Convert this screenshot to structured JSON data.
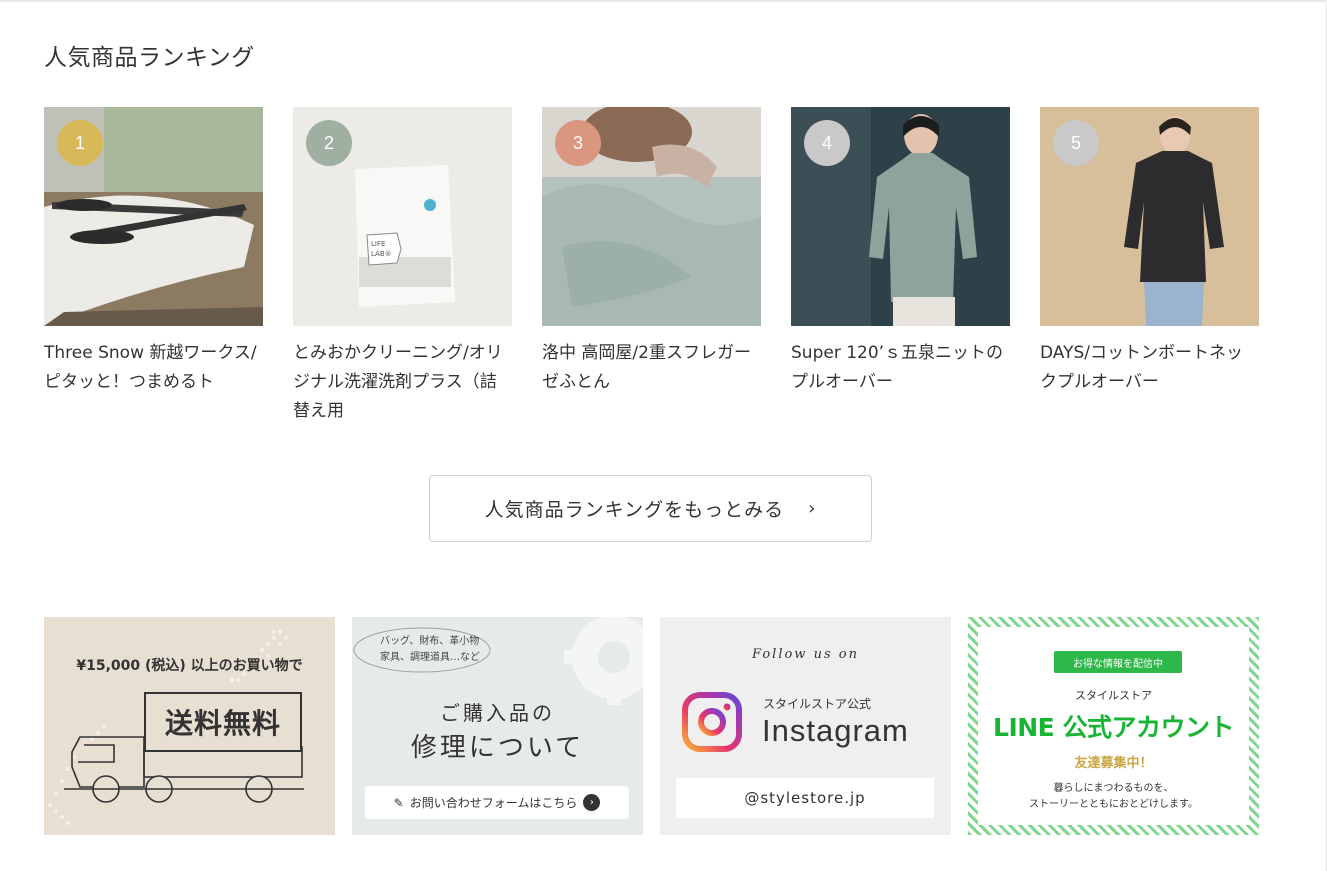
{
  "section": {
    "title": "人気商品ランキング"
  },
  "ranking": [
    {
      "rank": "1",
      "name": "Three Snow 新越ワークス/ピタッと！つまめるト",
      "badge_color": "#d8b95a"
    },
    {
      "rank": "2",
      "name": "とみおかクリーニング/オリジナル洗濯洗剤プラス（詰替え用",
      "badge_color": "#9fb0a2"
    },
    {
      "rank": "3",
      "name": "洛中 高岡屋/2重スフレガーゼふとん",
      "badge_color": "#d9977f"
    },
    {
      "rank": "4",
      "name": "Super 120’ｓ五泉ニットのプルオーバー",
      "badge_color": "#c9c9c9"
    },
    {
      "rank": "5",
      "name": "DAYS/コットンボートネックプルオーバー",
      "badge_color": "#c9c9c9"
    }
  ],
  "more_button": {
    "label": "人気商品ランキングをもっとみる",
    "chevron": "›"
  },
  "banners": {
    "shipping": {
      "line1": "¥15,000 (税込) 以上のお買い物で",
      "big": "送料無料"
    },
    "repair": {
      "small_line1": "バッグ、財布、革小物",
      "small_line2": "家具、調理道具…など",
      "heading1": "ご購入品の",
      "heading2": "修理について",
      "form_label": "お問い合わせフォームはこちら"
    },
    "instagram": {
      "follow": "Follow us on",
      "official": "スタイルストア公式",
      "name": "Instagram",
      "handle": "@stylestore.jp"
    },
    "line": {
      "ribbon": "お得な情報を配信中",
      "store": "スタイルストア",
      "title": "LINE 公式アカウント",
      "friend": "友達募集中！",
      "desc1": "暮らしにまつわるものを、",
      "desc2": "ストーリーとともにおとどけします。"
    }
  }
}
